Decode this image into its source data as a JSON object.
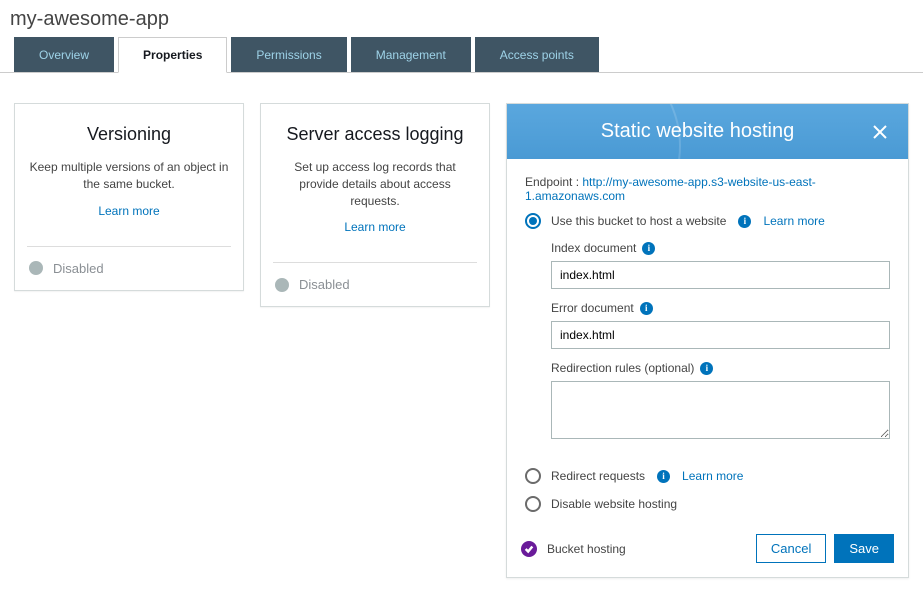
{
  "bucket_name": "my-awesome-app",
  "tabs": {
    "overview": "Overview",
    "properties": "Properties",
    "permissions": "Permissions",
    "management": "Management",
    "access_points": "Access points"
  },
  "cards": {
    "versioning": {
      "title": "Versioning",
      "desc": "Keep multiple versions of an object in the same bucket.",
      "learn": "Learn more",
      "status": "Disabled"
    },
    "logging": {
      "title": "Server access logging",
      "desc": "Set up access log records that provide details about access requests.",
      "learn": "Learn more",
      "status": "Disabled"
    }
  },
  "swh": {
    "title": "Static website hosting",
    "endpoint_label": "Endpoint : ",
    "endpoint_url": "http://my-awesome-app.s3-website-us-east-1.amazonaws.com",
    "opt_host": "Use this bucket to host a website",
    "learn_more": "Learn more",
    "index_label": "Index document",
    "index_value": "index.html",
    "error_label": "Error document",
    "error_value": "index.html",
    "redir_label": "Redirection rules (optional)",
    "redir_value": "",
    "opt_redirect": "Redirect requests",
    "opt_disable": "Disable website hosting",
    "footer_status": "Bucket hosting",
    "cancel": "Cancel",
    "save": "Save"
  }
}
